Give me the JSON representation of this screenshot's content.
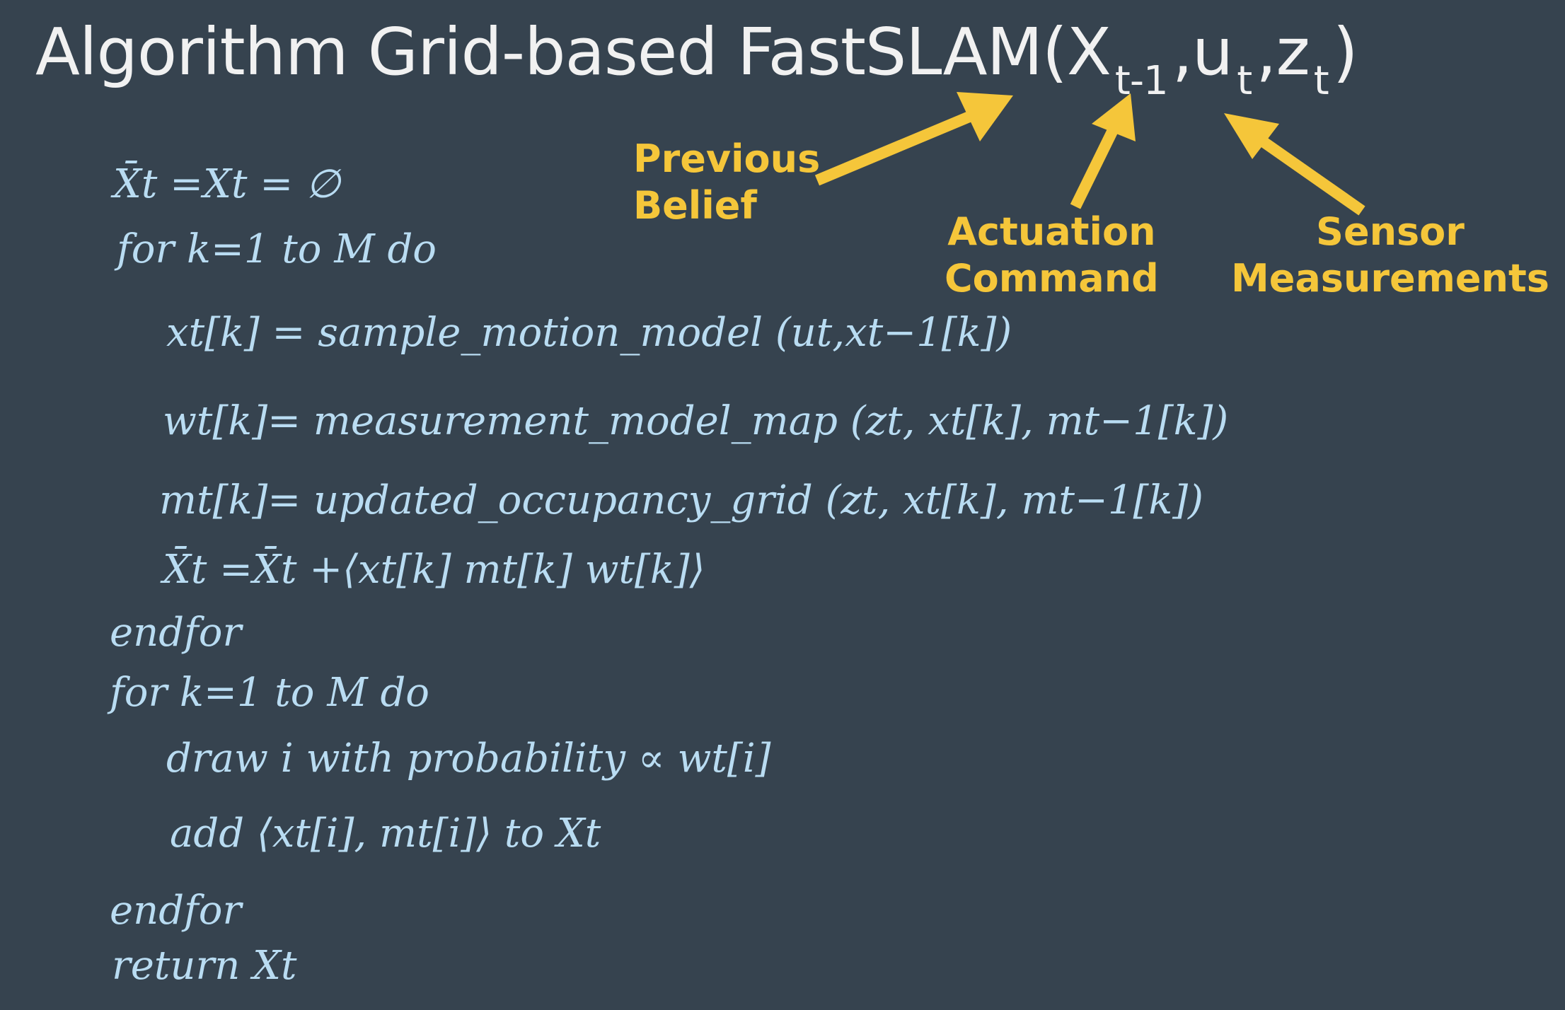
{
  "title": {
    "main": "Algorithm Grid-based FastSLAM(X",
    "sub1": "t-1",
    "comma1": ",u",
    "sub2": "t",
    "comma2": ",z",
    "sub3": "t",
    "close": ")"
  },
  "labels": {
    "previous_belief": [
      "Previous",
      "Belief"
    ],
    "actuation_command": [
      "Actuation",
      "Command"
    ],
    "sensor_measurements": [
      "Sensor",
      "Measurements"
    ]
  },
  "accent_color": "#f5c63a",
  "code_color": "#b9dcf2",
  "background_color": "#36434f",
  "algorithm": {
    "line1": "X̄t =Xt = ∅",
    "line2": "for k=1 to M do",
    "line3": "xt[k] = sample_motion_model (ut,xt−1[k])",
    "line4": "wt[k]= measurement_model_map (zt, xt[k], mt−1[k])",
    "line5": "mt[k]= updated_occupancy_grid (zt, xt[k], mt−1[k])",
    "line6": "X̄t =X̄t +⟨xt[k] mt[k] wt[k]⟩",
    "line7": "endfor",
    "line8": "for k=1 to M do",
    "line9": "draw i with probability ∝ wt[i]",
    "line10": "add ⟨xt[i], mt[i]⟩ to Xt",
    "line11": "endfor",
    "line12": "return Xt"
  }
}
